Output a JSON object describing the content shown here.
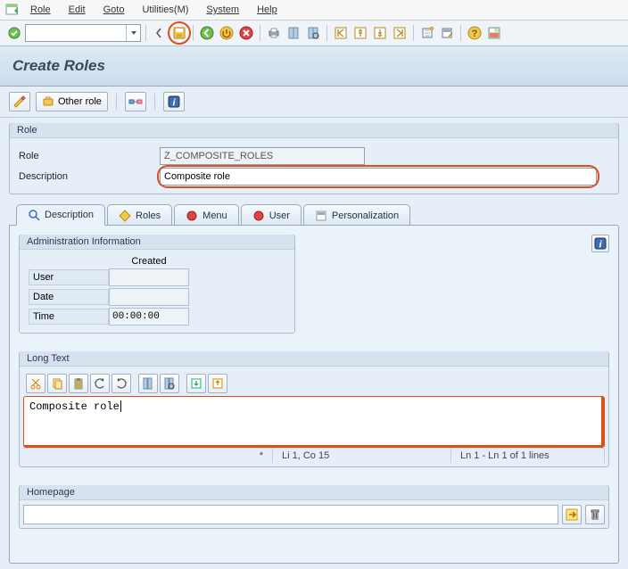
{
  "menu": {
    "items": [
      "Role",
      "Edit",
      "Goto",
      "Utilities(M)",
      "System",
      "Help"
    ]
  },
  "toolbar": {
    "command_value": ""
  },
  "page_title": "Create Roles",
  "app_toolbar": {
    "other_role_label": "Other role"
  },
  "role_group": {
    "title": "Role",
    "role_label": "Role",
    "role_value": "Z_COMPOSITE_ROLES",
    "description_label": "Description",
    "description_value": "Composite role"
  },
  "tabs": {
    "description": "Description",
    "roles": "Roles",
    "menu": "Menu",
    "user": "User",
    "personalization": "Personalization"
  },
  "admin_info": {
    "title": "Administration Information",
    "created_heading": "Created",
    "user_label": "User",
    "user_value": "",
    "date_label": "Date",
    "date_value": "",
    "time_label": "Time",
    "time_value": "00:00:00"
  },
  "long_text": {
    "title": "Long Text",
    "content": "Composite role",
    "status_star": "*",
    "status_pos": "Li 1, Co 15",
    "status_lines": "Ln 1 - Ln 1 of 1 lines"
  },
  "homepage": {
    "title": "Homepage",
    "value": ""
  }
}
